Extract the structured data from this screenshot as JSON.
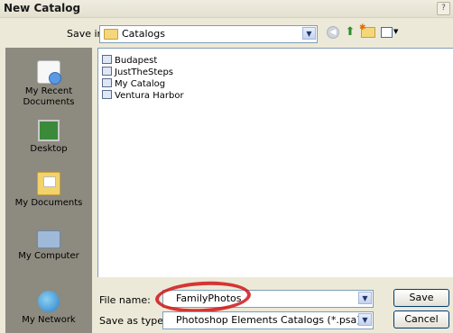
{
  "window": {
    "title": "New Catalog",
    "help": "?"
  },
  "save_in": {
    "label": "Save in:",
    "value": "Catalogs"
  },
  "places": [
    {
      "label": "My Recent Documents",
      "icon": "recent-documents-icon"
    },
    {
      "label": "Desktop",
      "icon": "desktop-icon"
    },
    {
      "label": "My Documents",
      "icon": "my-documents-icon"
    },
    {
      "label": "My Computer",
      "icon": "my-computer-icon"
    },
    {
      "label": "My Network",
      "icon": "my-network-icon"
    }
  ],
  "files": [
    "Budapest",
    "JustTheSteps",
    "My Catalog",
    "Ventura Harbor"
  ],
  "file_name": {
    "label": "File name:",
    "value": "FamilyPhotos"
  },
  "save_as_type": {
    "label": "Save as type:",
    "value": "Photoshop Elements Catalogs (*.psa)"
  },
  "buttons": {
    "save": "Save",
    "cancel": "Cancel"
  },
  "colors": {
    "highlight_ring": "#d0151a",
    "places_bar": "#8d8a7f",
    "dialog_bg": "#ece9d8"
  }
}
